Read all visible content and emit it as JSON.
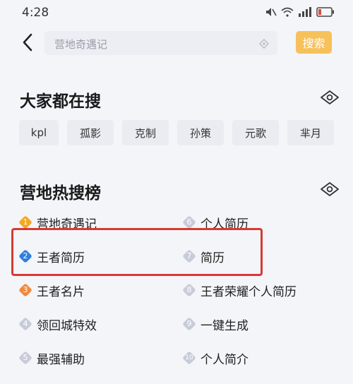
{
  "status_bar": {
    "time": "4:28"
  },
  "search": {
    "placeholder": "营地奇遇记",
    "button_label": "搜索"
  },
  "popular": {
    "title": "大家都在搜",
    "tags": [
      "kpl",
      "孤影",
      "克制",
      "孙策",
      "元歌",
      "芈月"
    ]
  },
  "hot": {
    "title": "营地热搜榜",
    "items": [
      {
        "rank": "1",
        "label": "营地奇遇记",
        "color": "#f5a623"
      },
      {
        "rank": "2",
        "label": "王者简历",
        "color": "#2f7fe0"
      },
      {
        "rank": "3",
        "label": "王者名片",
        "color": "#f08a3c"
      },
      {
        "rank": "4",
        "label": "领回城特效",
        "color": "#c7ccd9"
      },
      {
        "rank": "5",
        "label": "最强辅助",
        "color": "#c7ccd9"
      },
      {
        "rank": "6",
        "label": "个人简历",
        "color": "#c7ccd9"
      },
      {
        "rank": "7",
        "label": "简历",
        "color": "#c7ccd9"
      },
      {
        "rank": "8",
        "label": "王者荣耀个人简历",
        "color": "#c7ccd9"
      },
      {
        "rank": "9",
        "label": "一键生成",
        "color": "#c7ccd9"
      },
      {
        "rank": "10",
        "label": "个人简介",
        "color": "#c7ccd9"
      }
    ]
  },
  "colors": {
    "accent": "#f7c15a",
    "highlight": "#d63a32",
    "background": "#f4f5f9"
  }
}
